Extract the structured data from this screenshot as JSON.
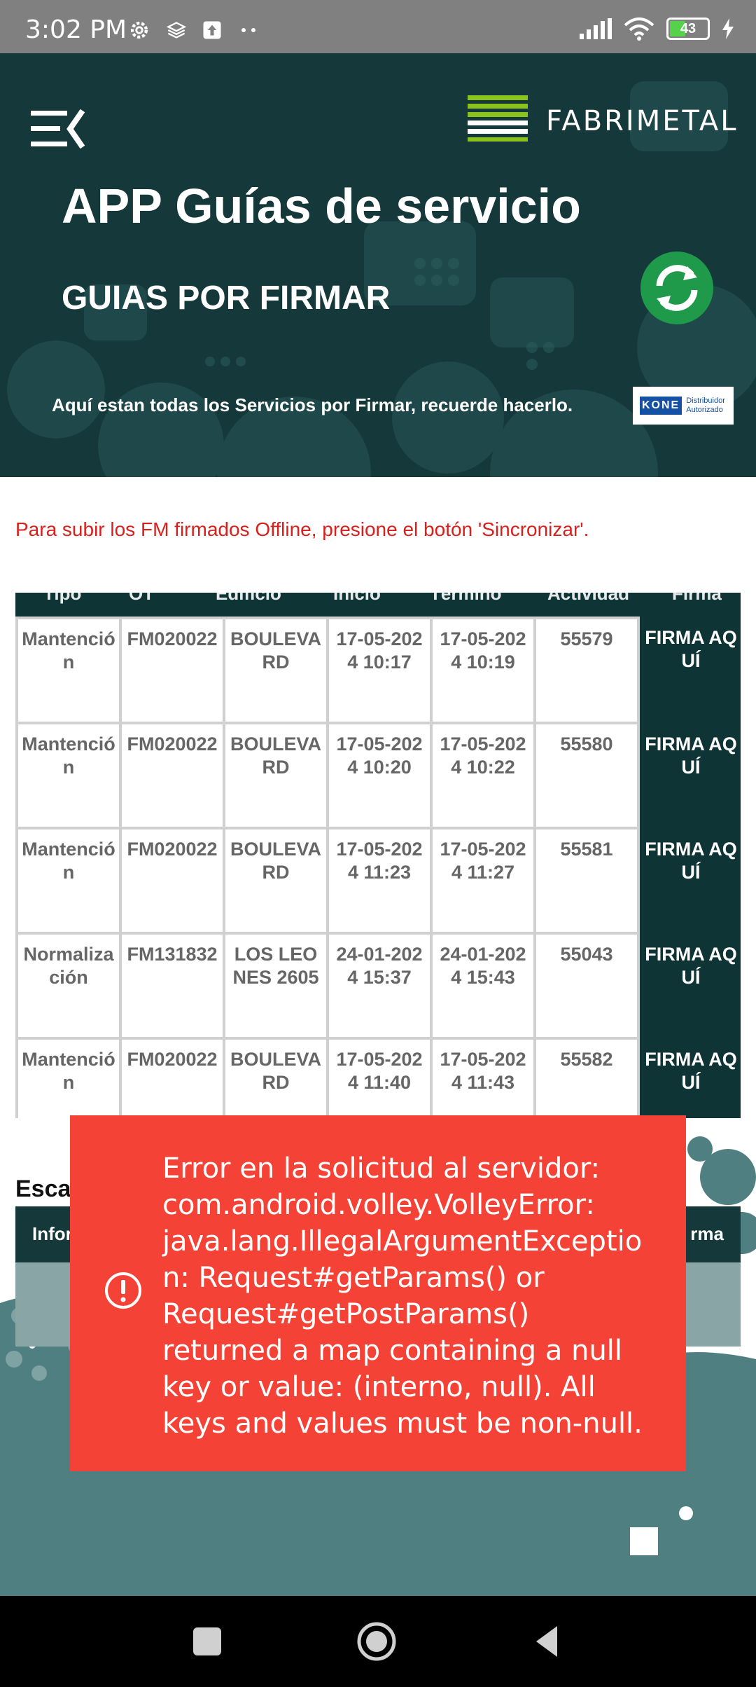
{
  "status_bar": {
    "time": "3:02 PM",
    "battery_level": "43",
    "icons": [
      "settings-icon",
      "layers-icon",
      "upload-icon",
      "more-dots-icon",
      "signal-icon",
      "wifi-icon",
      "battery-icon",
      "charging-icon"
    ]
  },
  "header": {
    "brand": "FABRIMETAL",
    "app_title": "APP Guías de servicio",
    "subtitle": "GUIAS POR FIRMAR",
    "note": "Aquí estan todas los Servicios por Firmar, recuerde hacerlo.",
    "kone_logo": "KONE",
    "kone_sub": "Distribuidor Autorizado"
  },
  "offline_message": "Para subir los FM firmados Offline, presione el botón 'Sincronizar'.",
  "table": {
    "partial_headers": [
      "Tipo",
      "OT",
      "Edificio",
      "Inicio",
      "Término",
      "Actividad",
      "Firma"
    ],
    "rows": [
      {
        "tipo": "Mantención",
        "ot": "FM020022",
        "edificio": "BOULEVARD",
        "inicio": "17-05-2024 10:17",
        "termino": "17-05-2024 10:19",
        "actividad": "55579",
        "firma": "FIRMA AQUÍ"
      },
      {
        "tipo": "Mantención",
        "ot": "FM020022",
        "edificio": "BOULEVARD",
        "inicio": "17-05-2024 10:20",
        "termino": "17-05-2024 10:22",
        "actividad": "55580",
        "firma": "FIRMA AQUÍ"
      },
      {
        "tipo": "Mantención",
        "ot": "FM020022",
        "edificio": "BOULEVARD",
        "inicio": "17-05-2024 11:23",
        "termino": "17-05-2024 11:27",
        "actividad": "55581",
        "firma": "FIRMA AQUÍ"
      },
      {
        "tipo": "Normalización",
        "ot": "FM131832",
        "edificio": "LOS LEONES 2605",
        "inicio": "24-01-2024 15:37",
        "termino": "24-01-2024 15:43",
        "actividad": "55043",
        "firma": "FIRMA AQUÍ"
      },
      {
        "tipo": "Mantención",
        "ot": "FM020022",
        "edificio": "BOULEVARD",
        "inicio": "17-05-2024 11:40",
        "termino": "17-05-2024 11:43",
        "actividad": "55582",
        "firma": "FIRMA AQUÍ"
      }
    ]
  },
  "lower": {
    "title": "Esca",
    "header_left": "Infor",
    "header_right": "rma"
  },
  "toast": {
    "message": "Error en la solicitud al servidor: com.android.volley.VolleyError: java.lang.IllegalArgumentException: Request#getParams() or Request#getPostParams() returned a map containing a null key or value: (interno, null). All keys and values must be non-null."
  },
  "nav": [
    "recents-button",
    "home-button",
    "back-button"
  ]
}
